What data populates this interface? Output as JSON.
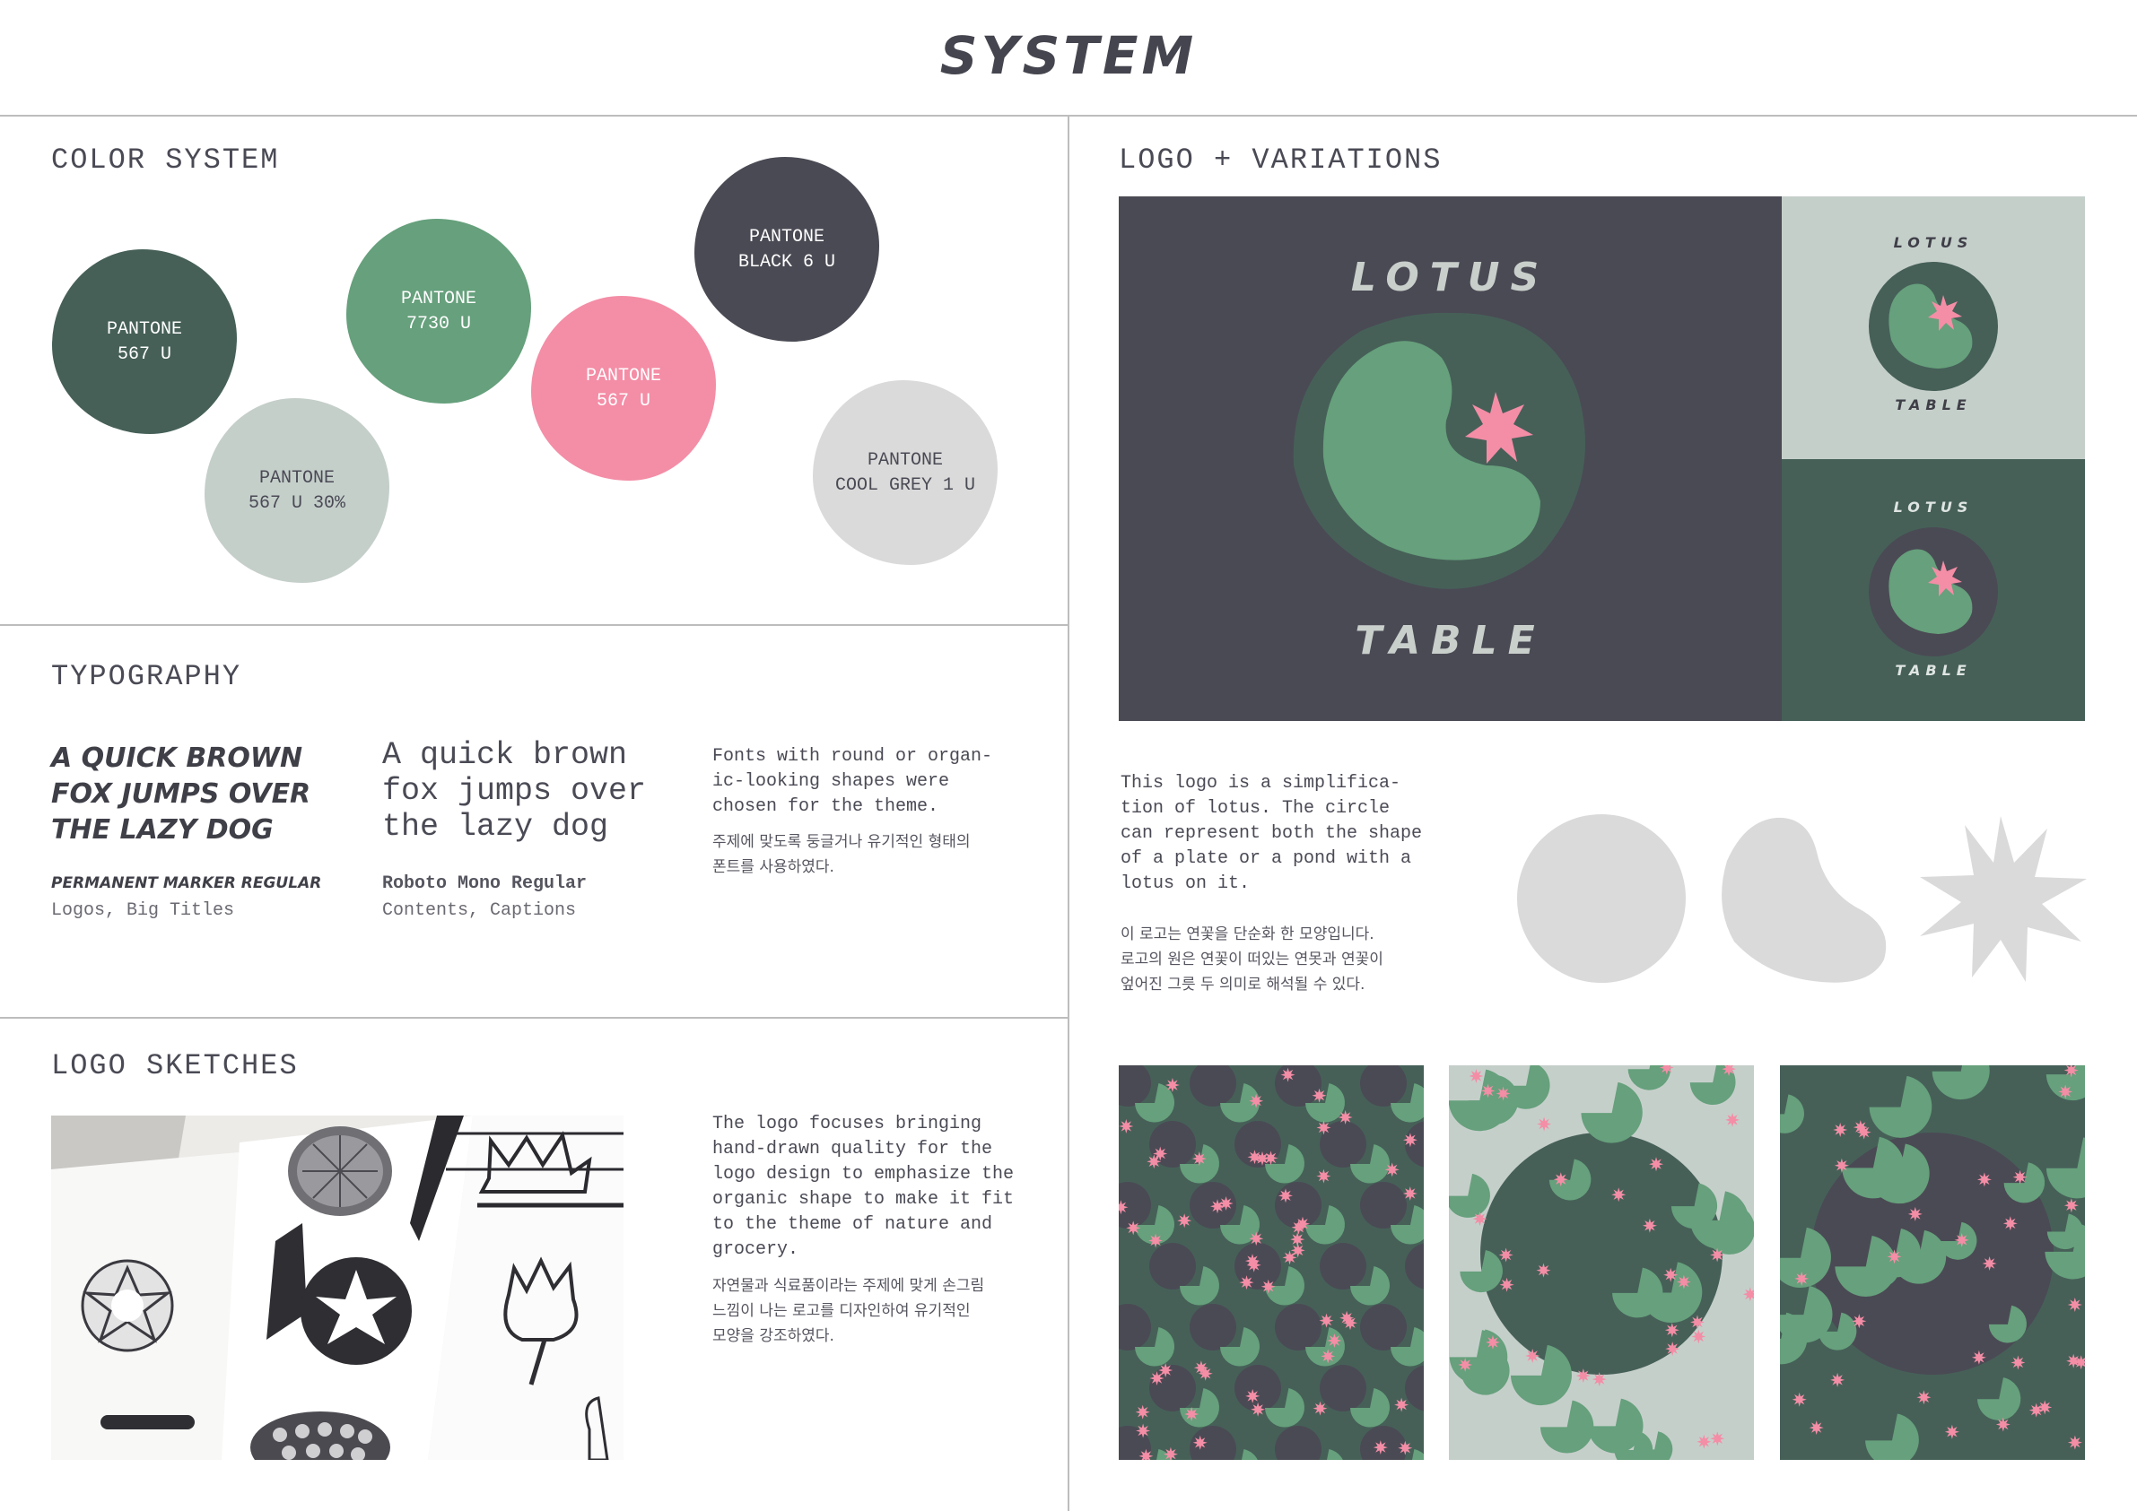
{
  "header": {
    "title": "SYSTEM"
  },
  "color_system": {
    "title": "COLOR SYSTEM",
    "swatches": [
      {
        "label": "PANTONE\n567 U",
        "color": "#466058",
        "text_color": "#ffffff"
      },
      {
        "label": "PANTONE\n567 U 30%",
        "color": "#c5cfca",
        "text_color": "#4a4a55"
      },
      {
        "label": "PANTONE\n7730 U",
        "color": "#66a07c",
        "text_color": "#ffffff"
      },
      {
        "label": "PANTONE\n567 U",
        "color": "#f48da6",
        "text_color": "#ffffff"
      },
      {
        "label": "PANTONE\nBLACK 6 U",
        "color": "#4a4a54",
        "text_color": "#ffffff"
      },
      {
        "label": "PANTONE\nCOOL GREY 1 U",
        "color": "#dadada",
        "text_color": "#4a4a55"
      }
    ]
  },
  "typography": {
    "title": "TYPOGRAPHY",
    "marker_sample": [
      "A QUICK BROWN",
      "FOX JUMPS OVER",
      "THE LAZY DOG"
    ],
    "marker_name": "Permanent Marker Regular",
    "marker_use": "Logos, Big Titles",
    "mono_sample": [
      "A quick brown",
      "fox jumps over",
      "the lazy dog"
    ],
    "mono_name": "Roboto Mono Regular",
    "mono_use": "Contents, Captions",
    "description_en": "Fonts with round or organ-\nic-looking shapes were\nchosen for the theme.",
    "description_kr": "주제에 맞도록 둥글거나 유기적인 형태의\n폰트를 사용하였다."
  },
  "logo_sketches": {
    "title": "LOGO SKETCHES",
    "description_en": "The logo focuses bringing\nhand-drawn quality for the\nlogo design to emphasize the\norganic shape to make it fit\nto the theme of nature and\ngrocery.",
    "description_kr": "자연물과 식료품이라는 주제에 맞게 손그림\n느낌이 나는 로고를 디자인하여 유기적인\n모양을 강조하였다."
  },
  "logo_variations": {
    "title": "LOGO + VARIATIONS",
    "logo_top": "LOTUS",
    "logo_bottom": "TABLE",
    "description_en": "This logo is a simplifica-\ntion of lotus. The circle\ncan represent both the shape\nof a plate or a pond with a\nlotus on it.",
    "description_kr": "이 로고는 연꽃을 단순화 한 모양입니다.\n로고의 원은 연꽃이 떠있는 연못과 연꽃이\n엎어진 그릇 두 의미로 해석될 수 있다."
  },
  "colors": {
    "dark_green": "#466058",
    "green": "#66a07c",
    "pink": "#f48da6",
    "charcoal": "#4a4a54",
    "light_green_grey": "#c5cfca",
    "light_grey": "#dadada",
    "divider": "#bdbdbd"
  }
}
